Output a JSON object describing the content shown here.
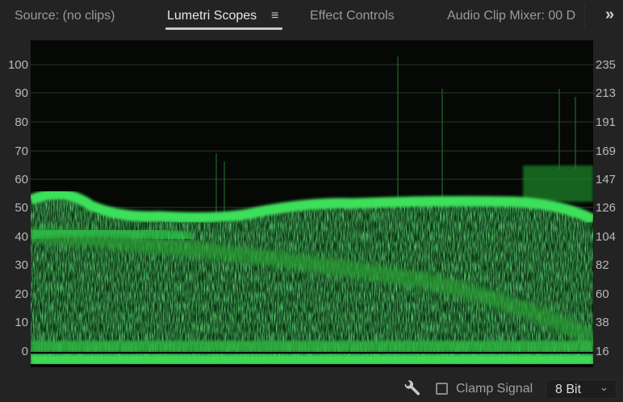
{
  "tabs": [
    {
      "label": "Source: (no clips)",
      "active": false
    },
    {
      "label": "Lumetri Scopes",
      "active": true
    },
    {
      "label": "Effect Controls",
      "active": false
    },
    {
      "label": "Audio Clip Mixer: 00 D",
      "active": false
    }
  ],
  "tab_menu_icon": "≡",
  "overflow_icon": "»",
  "scope": {
    "type": "waveform-luma",
    "left_scale": [
      "100",
      "90",
      "80",
      "70",
      "60",
      "50",
      "40",
      "30",
      "20",
      "10",
      "0"
    ],
    "right_scale": [
      "235",
      "213",
      "191",
      "169",
      "147",
      "126",
      "104",
      "82",
      "60",
      "38",
      "16"
    ],
    "trace_color": "#2fd04a"
  },
  "footer": {
    "settings_icon": "wrench-icon",
    "clamp_signal_label": "Clamp Signal",
    "clamp_signal_checked": false,
    "bit_depth_value": "8 Bit"
  }
}
